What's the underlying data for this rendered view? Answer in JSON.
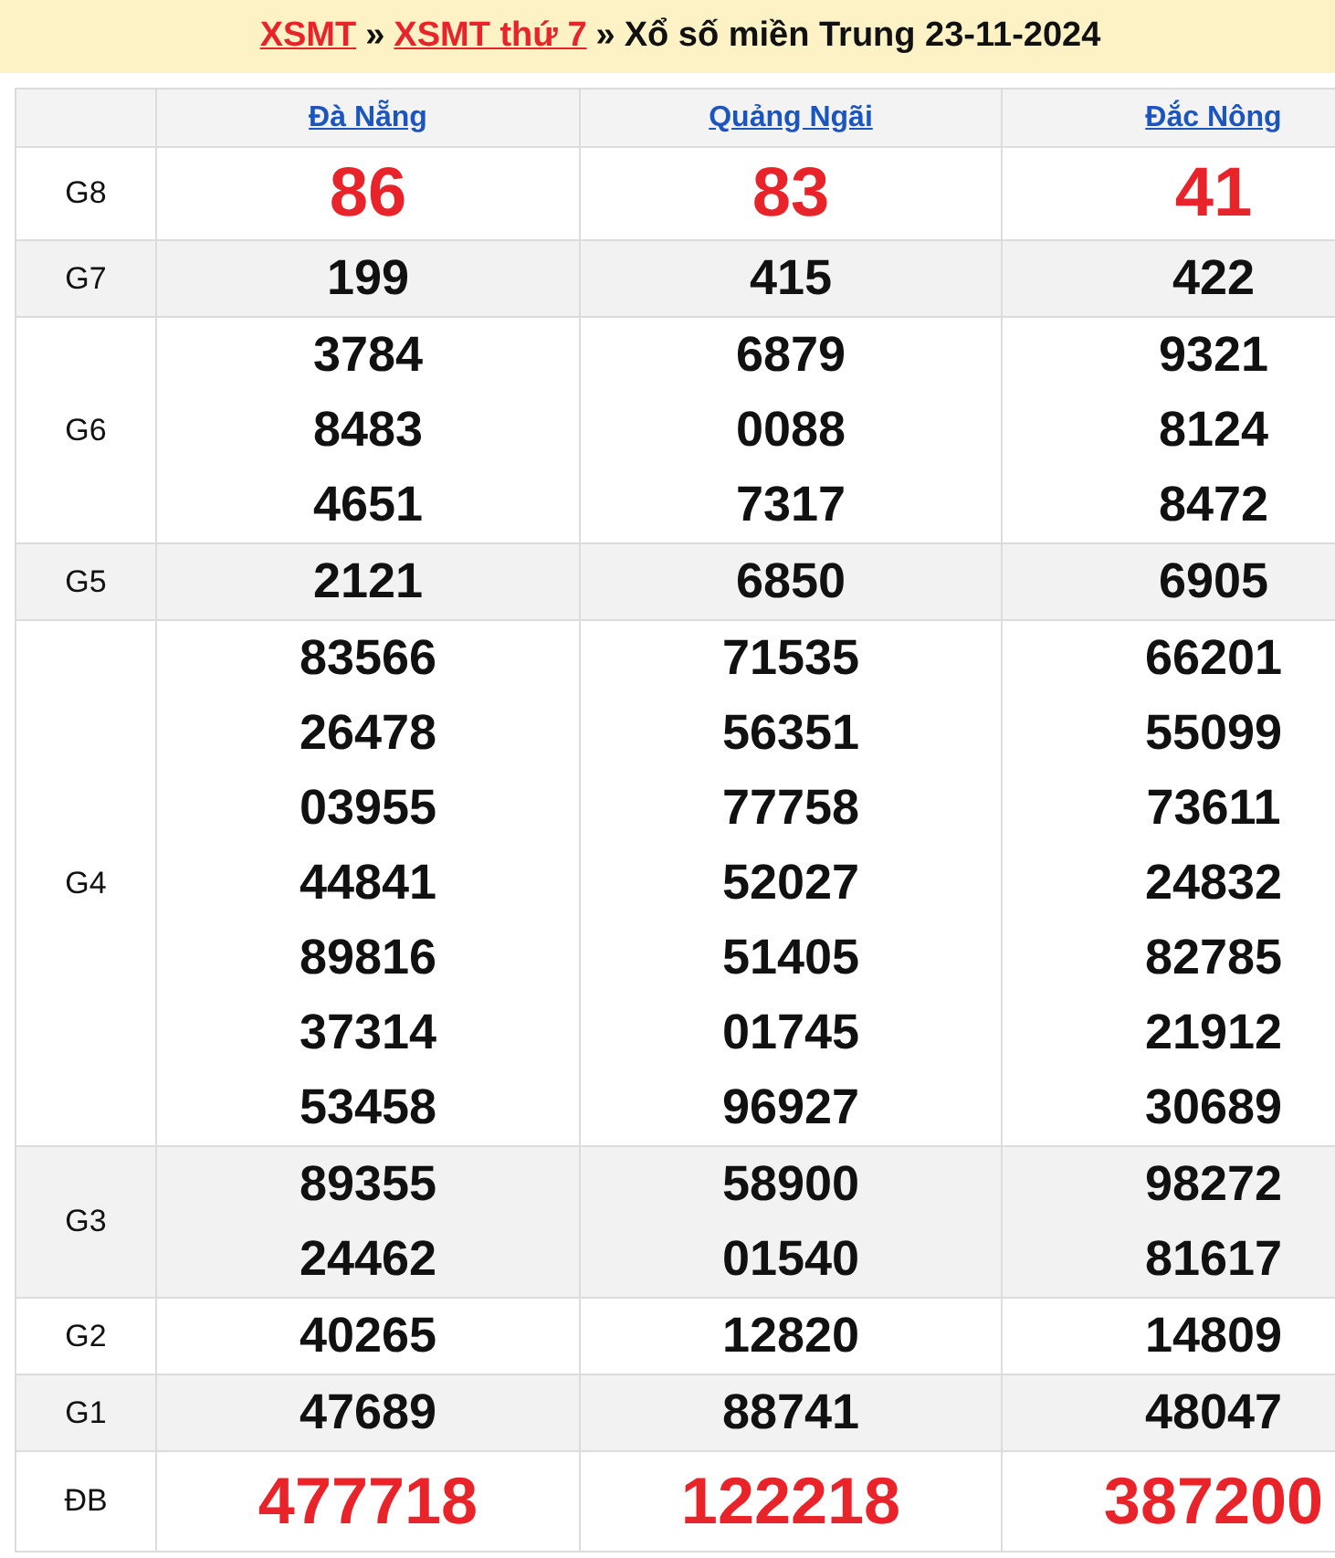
{
  "breadcrumb": [
    {
      "text": "XSMT",
      "kind": "link"
    },
    {
      "text": "»",
      "kind": "separator"
    },
    {
      "text": "XSMT thứ 7",
      "kind": "link"
    },
    {
      "text": "»",
      "kind": "separator"
    },
    {
      "text": "Xổ số miền Trung 23-11-2024",
      "kind": "title"
    }
  ],
  "table": {
    "columns": [
      "Đà Nẵng",
      "Quảng Ngãi",
      "Đắc Nông"
    ],
    "rows": [
      {
        "prize": "G8",
        "kind": "highlight",
        "cells": [
          [
            "86"
          ],
          [
            "83"
          ],
          [
            "41"
          ]
        ]
      },
      {
        "prize": "G7",
        "kind": "plain",
        "cells": [
          [
            "199"
          ],
          [
            "415"
          ],
          [
            "422"
          ]
        ]
      },
      {
        "prize": "G6",
        "kind": "plain",
        "cells": [
          [
            "3784",
            "8483",
            "4651"
          ],
          [
            "6879",
            "0088",
            "7317"
          ],
          [
            "9321",
            "8124",
            "8472"
          ]
        ]
      },
      {
        "prize": "G5",
        "kind": "plain",
        "cells": [
          [
            "2121"
          ],
          [
            "6850"
          ],
          [
            "6905"
          ]
        ]
      },
      {
        "prize": "G4",
        "kind": "plain",
        "cells": [
          [
            "83566",
            "26478",
            "03955",
            "44841",
            "89816",
            "37314",
            "53458"
          ],
          [
            "71535",
            "56351",
            "77758",
            "52027",
            "51405",
            "01745",
            "96927"
          ],
          [
            "66201",
            "55099",
            "73611",
            "24832",
            "82785",
            "21912",
            "30689"
          ]
        ]
      },
      {
        "prize": "G3",
        "kind": "plain",
        "cells": [
          [
            "89355",
            "24462"
          ],
          [
            "58900",
            "01540"
          ],
          [
            "98272",
            "81617"
          ]
        ]
      },
      {
        "prize": "G2",
        "kind": "plain",
        "cells": [
          [
            "40265"
          ],
          [
            "12820"
          ],
          [
            "14809"
          ]
        ]
      },
      {
        "prize": "G1",
        "kind": "plain",
        "cells": [
          [
            "47689"
          ],
          [
            "88741"
          ],
          [
            "48047"
          ]
        ]
      },
      {
        "prize": "ĐB",
        "kind": "special",
        "cells": [
          [
            "477718"
          ],
          [
            "122218"
          ],
          [
            "387200"
          ]
        ]
      }
    ]
  }
}
